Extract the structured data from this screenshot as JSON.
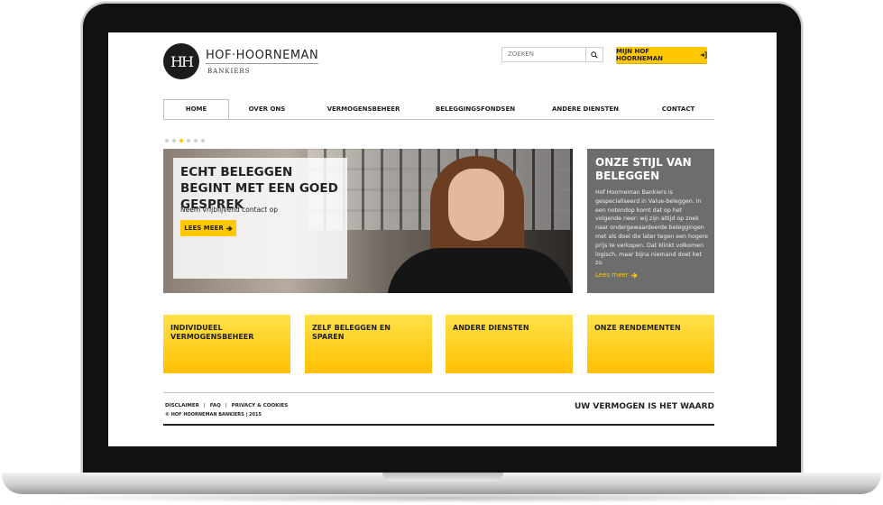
{
  "brand": {
    "logo_mark": "HH",
    "name": "HOF·HOORNEMAN",
    "subtitle": "BANKIERS"
  },
  "header": {
    "search_placeholder": "ZOEKEN",
    "account_button": "MIJN HOF HOORNEMAN"
  },
  "nav": {
    "items": [
      {
        "label": "HOME",
        "active": true
      },
      {
        "label": "OVER ONS"
      },
      {
        "label": "VERMOGENSBEHEER"
      },
      {
        "label": "BELEGGINGSFONDSEN"
      },
      {
        "label": "ANDERE DIENSTEN"
      },
      {
        "label": "CONTACT"
      }
    ]
  },
  "slider": {
    "dots_count": 6,
    "active_dot": 3
  },
  "hero": {
    "title": "ECHT BELEGGEN BEGINT MET EEN GOED GESPREK",
    "subtitle": "Neem vrijblijvend contact op",
    "button": "LEES MEER"
  },
  "style_box": {
    "title": "ONZE STIJL VAN BELEGGEN",
    "text": "Hof Hoorneman Bankiers is gespecialiseerd in Value-beleggen. In een notendop komt dat op het volgende neer: wij zijn altijd op zoek naar ondergewaardeerde beleggingen met als doel die later tegen een hogere prijs te verkopen. Dat klinkt volkomen logisch, maar bijna niemand doet het zo.",
    "link": "Lees meer"
  },
  "tiles": [
    {
      "label": "INDIVIDUEEL VERMOGENSBEHEER"
    },
    {
      "label": "ZELF BELEGGEN EN SPAREN"
    },
    {
      "label": "ANDERE DIENSTEN"
    },
    {
      "label": "ONZE RENDEMENTEN"
    }
  ],
  "footer": {
    "links": [
      "DISCLAIMER",
      "FAQ",
      "PRIVACY & COOKIES"
    ],
    "separator": "|",
    "copyright": "© HOF HOORNEMAN BANKIERS | 2015",
    "tagline": "UW VERMOGEN IS HET WAARD"
  },
  "colors": {
    "accent": "#ffc800",
    "panel_gray": "#6d6d6d",
    "text_dark": "#222222"
  },
  "icons": {
    "search": "search-icon",
    "login": "login-icon",
    "arrow": "arrow-right-icon"
  }
}
